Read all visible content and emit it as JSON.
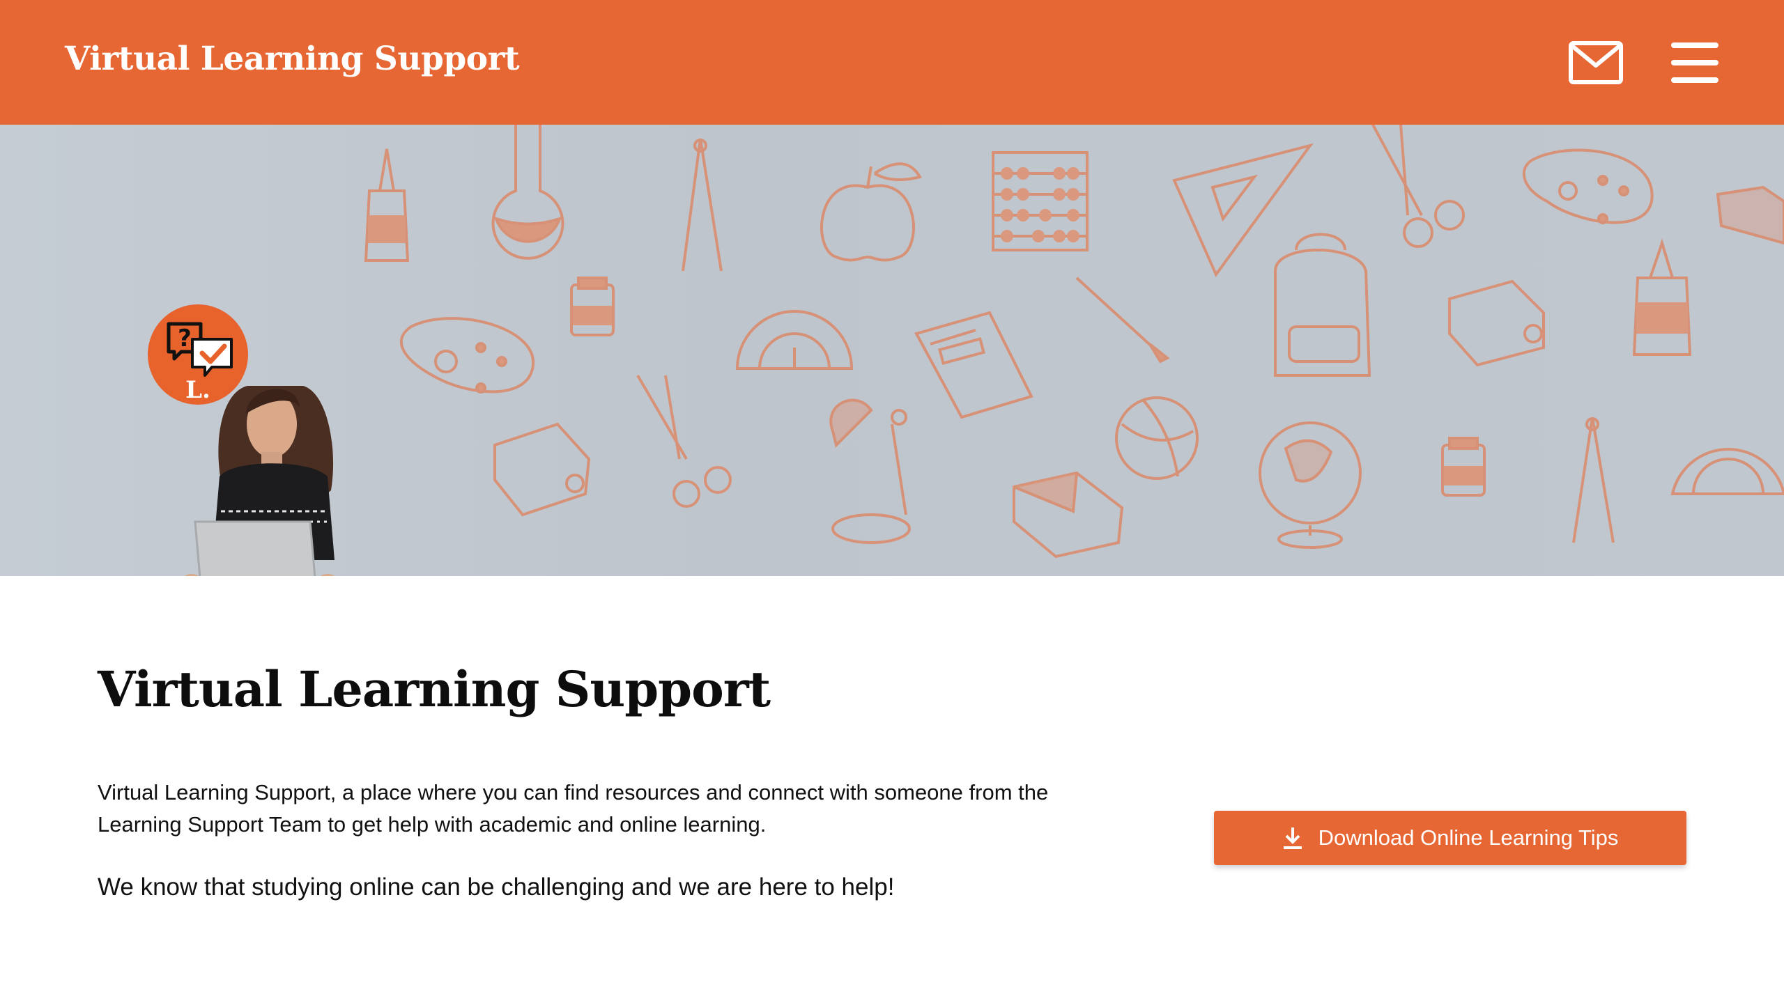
{
  "header": {
    "site_title": "Virtual Learning Support",
    "icons": {
      "mail": "mail-icon",
      "menu": "hamburger-menu-icon"
    },
    "brand_color": "#e76734"
  },
  "hero": {
    "logo_letter": "L.",
    "logo_icons": [
      "question-bubble-icon",
      "checkmark-bubble-icon"
    ],
    "illustration": "school-supplies-doodle-pattern",
    "photo": "student-with-laptop"
  },
  "main": {
    "title": "Virtual Learning Support",
    "intro": "Virtual Learning Support, a place where you can find resources and connect with someone from the Learning Support Team to get help with academic and online learning.",
    "tagline": "We know that studying online can be challenging and we are here to help!",
    "download_button": {
      "label": "Download Online Learning Tips",
      "icon": "download-icon"
    }
  }
}
